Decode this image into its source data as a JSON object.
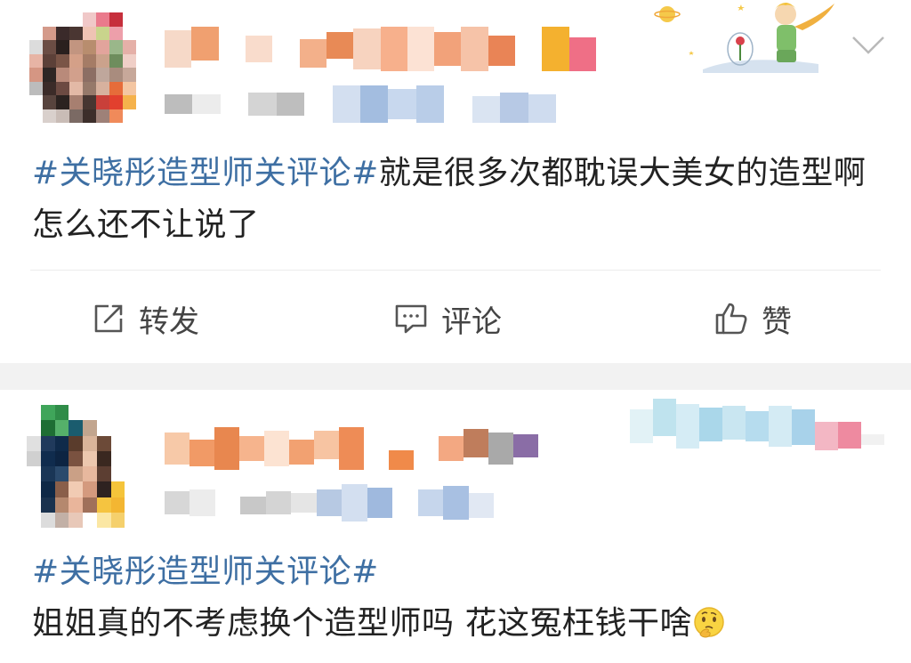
{
  "posts": [
    {
      "hashtag": "#关晓彤造型师关评论#",
      "body": "就是很多次都耽误大美女的造型啊 怎么还不让说了"
    },
    {
      "hashtag": "#关晓彤造型师关评论#",
      "body": "姐姐真的不考虑换个造型师吗 花这冤枉钱干啥"
    }
  ],
  "actions": {
    "repost": "转发",
    "comment": "评论",
    "like": "赞"
  },
  "icons": {
    "repost": "repost-icon",
    "comment": "comment-icon",
    "like": "thumbs-up-icon",
    "more": "chevron-down-icon",
    "emoji": "thinking-face-emoji"
  },
  "colors": {
    "hashtag": "#3e6fa3",
    "text": "#222222",
    "separator": "#f2f2f2"
  }
}
